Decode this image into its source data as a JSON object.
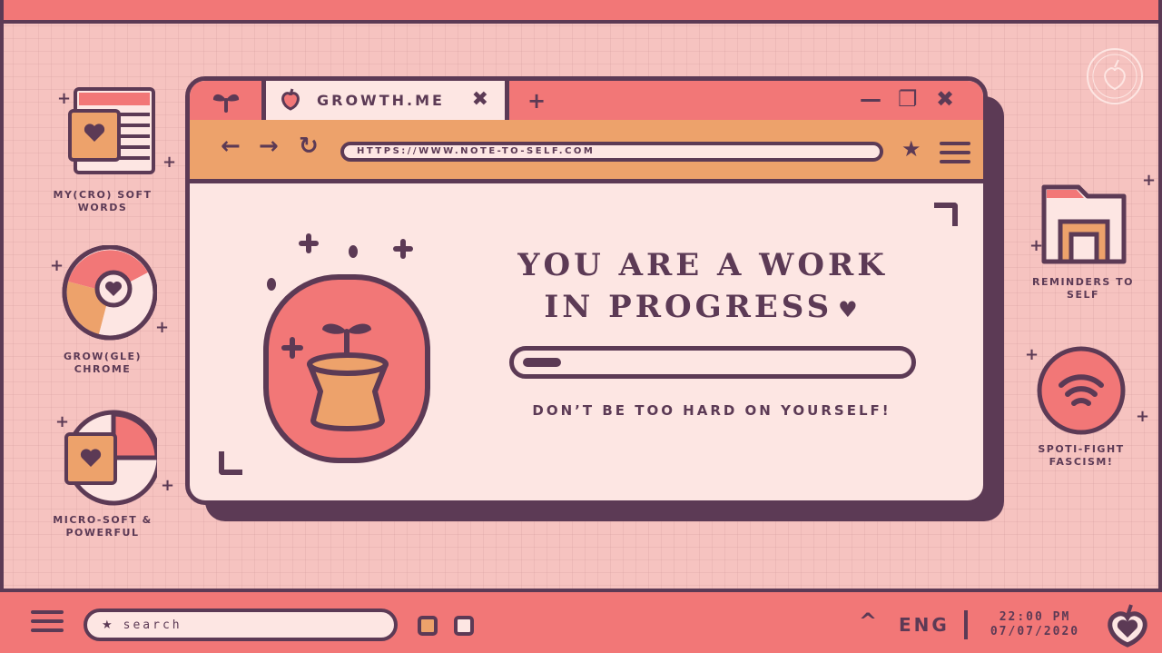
{
  "desktop": {
    "icons": [
      {
        "label": "MY(CRO) SOFT WORDS"
      },
      {
        "label": "GROW(GLE) CHROME"
      },
      {
        "label": "MICRO-SOFT & POWERFUL"
      },
      {
        "label": "REMINDERS TO SELF"
      },
      {
        "label": "SPOTI-FIGHT FASCISM!"
      }
    ]
  },
  "browser": {
    "tab": {
      "title": "GROWTH.ME",
      "close": "✖"
    },
    "new_tab": "+",
    "controls": {
      "minimize": "—",
      "maximize": "❐",
      "close": "✖"
    },
    "nav": {
      "back": "←",
      "forward": "→",
      "reload": "↻"
    },
    "url": "HTTPS://WWW.NOTE-TO-SELF.COM",
    "bookmark": "★",
    "content": {
      "headline_line1": "YOU ARE A WORK",
      "headline_line2": "IN PROGRESS",
      "heart": "♥",
      "progress": 0.1,
      "subtext": "DON’T BE TOO HARD ON YOURSELF!"
    }
  },
  "taskbar": {
    "search_placeholder": "search",
    "search_star": "★",
    "chevron": "^",
    "language": "ENG",
    "time": "22:00 PM",
    "date": "07/07/2020"
  },
  "colors": {
    "background": "#f6c3c0",
    "outline": "#5c3a55",
    "coral": "#f27777",
    "tan": "#eda26b",
    "cream": "#fde6e3"
  }
}
